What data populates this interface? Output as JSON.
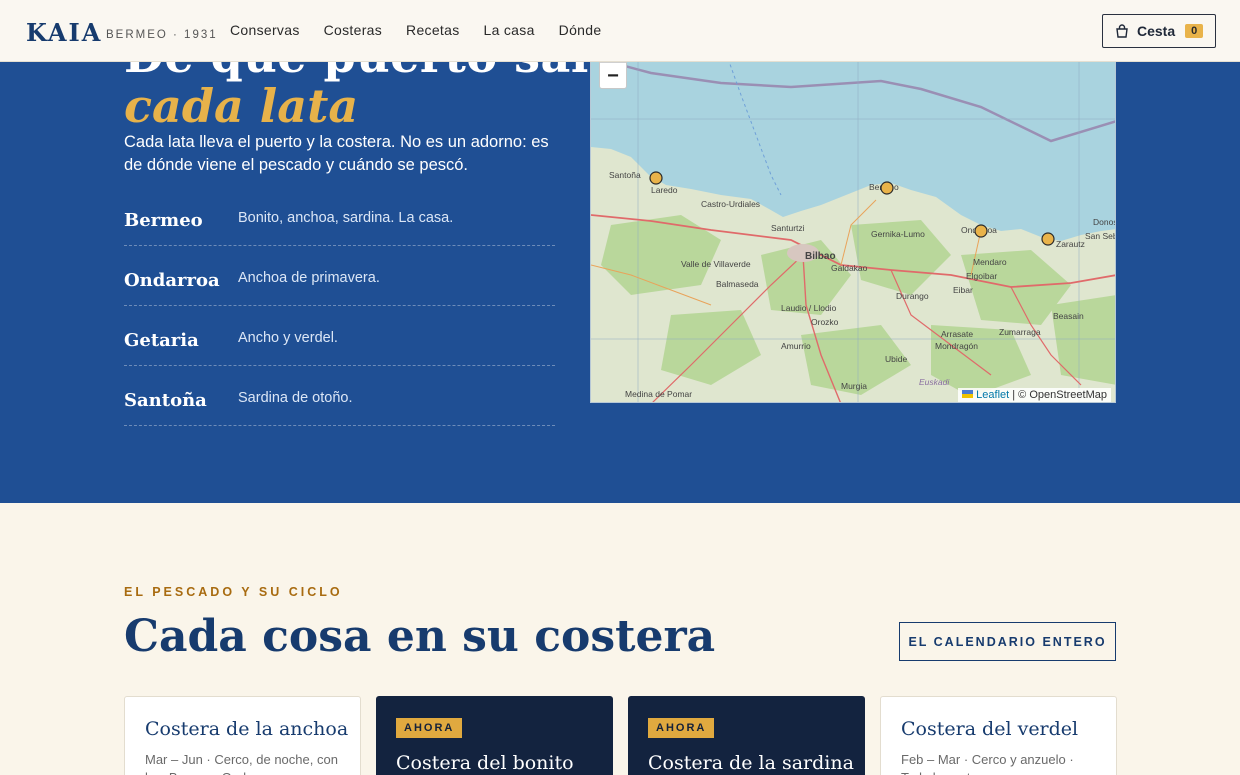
{
  "header": {
    "logo": "KAIA",
    "logo_sub": "BERMEO · 1931",
    "nav": [
      "Conservas",
      "Costeras",
      "Recetas",
      "La casa",
      "Dónde"
    ],
    "cart_label": "Cesta",
    "cart_count": "0"
  },
  "hero": {
    "title": "De qué puerto sale",
    "title_accent": "cada lata",
    "description": "Cada lata lleva el puerto y la costera. No es un adorno: es de dónde viene el pescado y cuándo se pescó.",
    "ports": [
      {
        "name": "Bermeo",
        "desc": "Bonito, anchoa, sardina. La casa."
      },
      {
        "name": "Ondarroa",
        "desc": "Anchoa de primavera."
      },
      {
        "name": "Getaria",
        "desc": "Ancho y verdel."
      },
      {
        "name": "Santoña",
        "desc": "Sardina de otoño."
      }
    ]
  },
  "map": {
    "zoom_in": "+",
    "zoom_out": "−",
    "attribution_leaflet": "Leaflet",
    "attribution_osm": "| © OpenStreetMap",
    "place_labels": [
      "Santoña",
      "Laredo",
      "Castro-Urdiales",
      "Santurtzi",
      "Bermeo",
      "Gernika-Lumo",
      "Ondarroa",
      "Donostia",
      "San Sebastián",
      "Zarautz",
      "Valle de Villaverde",
      "Bilbao",
      "Galdakao",
      "Balmaseda",
      "Mendaro",
      "Elgoibar",
      "Eibar",
      "Laudio / Llodio",
      "Durango",
      "Zumarraga",
      "Beasain",
      "Arrasate",
      "Mondragón",
      "Orozko",
      "Amurrio",
      "Ubide",
      "Murgia",
      "Euskadi",
      "Medina de Pomar"
    ],
    "colors": {
      "sea": "#a9d3df",
      "land": "#dfe6cf",
      "forest": "#b9d79b",
      "road": "#e06a6a",
      "marker": "#e9b34a"
    }
  },
  "section": {
    "eyebrow": "EL PESCADO Y SU CICLO",
    "title": "Cada cosa en su costera",
    "button": "EL CALENDARIO ENTERO"
  },
  "cards": [
    {
      "title": "Costera de la anchoa",
      "meta": "Mar – Jun · Cerco, de noche, con luz. Bermeo, Ondarroa.",
      "badge": ""
    },
    {
      "title": "Costera del bonito",
      "meta": "",
      "badge": "AHORA"
    },
    {
      "title": "Costera de la sardina",
      "meta": "",
      "badge": "AHORA"
    },
    {
      "title": "Costera del verdel",
      "meta": "Feb – Mar · Cerco y anzuelo · Toda la costa.",
      "badge": ""
    }
  ]
}
